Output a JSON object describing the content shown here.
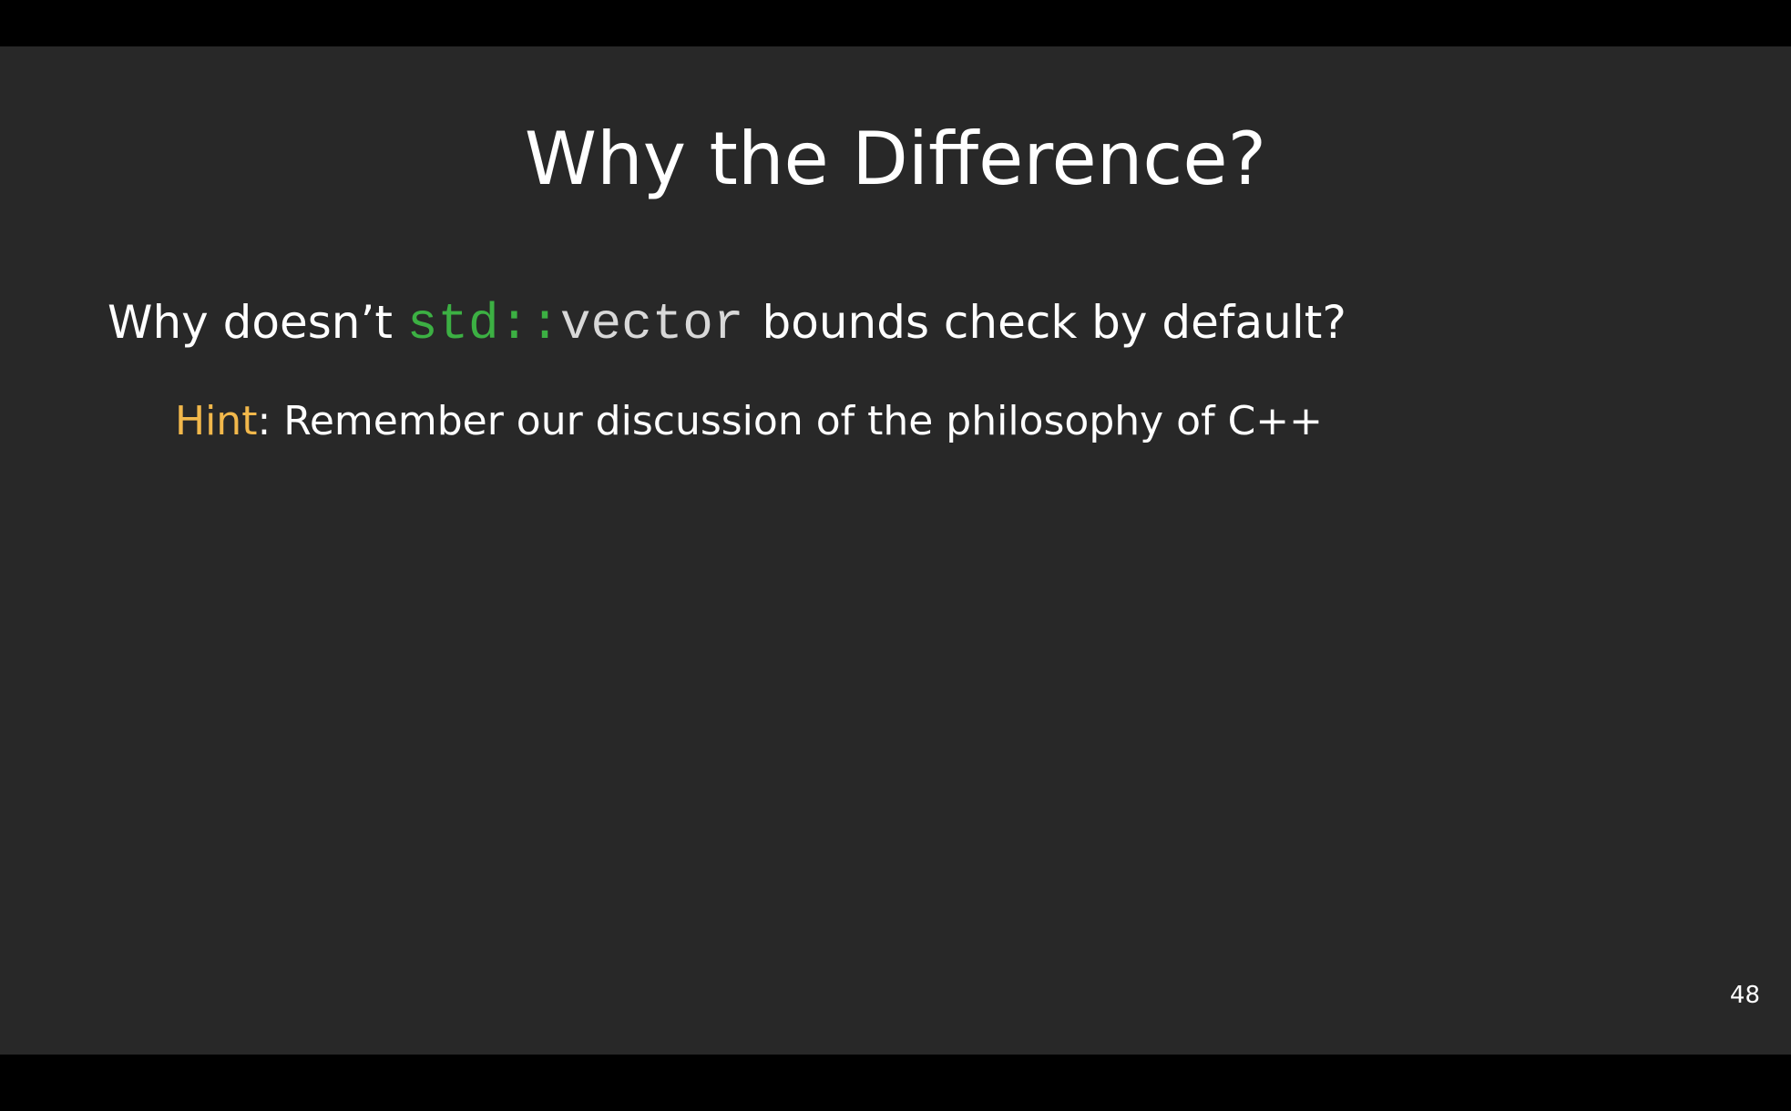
{
  "slide": {
    "title": "Why the Difference?",
    "question": {
      "prefix": "Why doesn’t ",
      "code_namespace": "std::",
      "code_name": "vector",
      "suffix": "bounds check by default?"
    },
    "hint": {
      "label": "Hint",
      "text": ": Remember our discussion of the philosophy of C++"
    },
    "page_number": "48"
  },
  "colors": {
    "background": "#282828",
    "code_namespace": "#3cb043",
    "hint_label": "#f2b84b"
  }
}
